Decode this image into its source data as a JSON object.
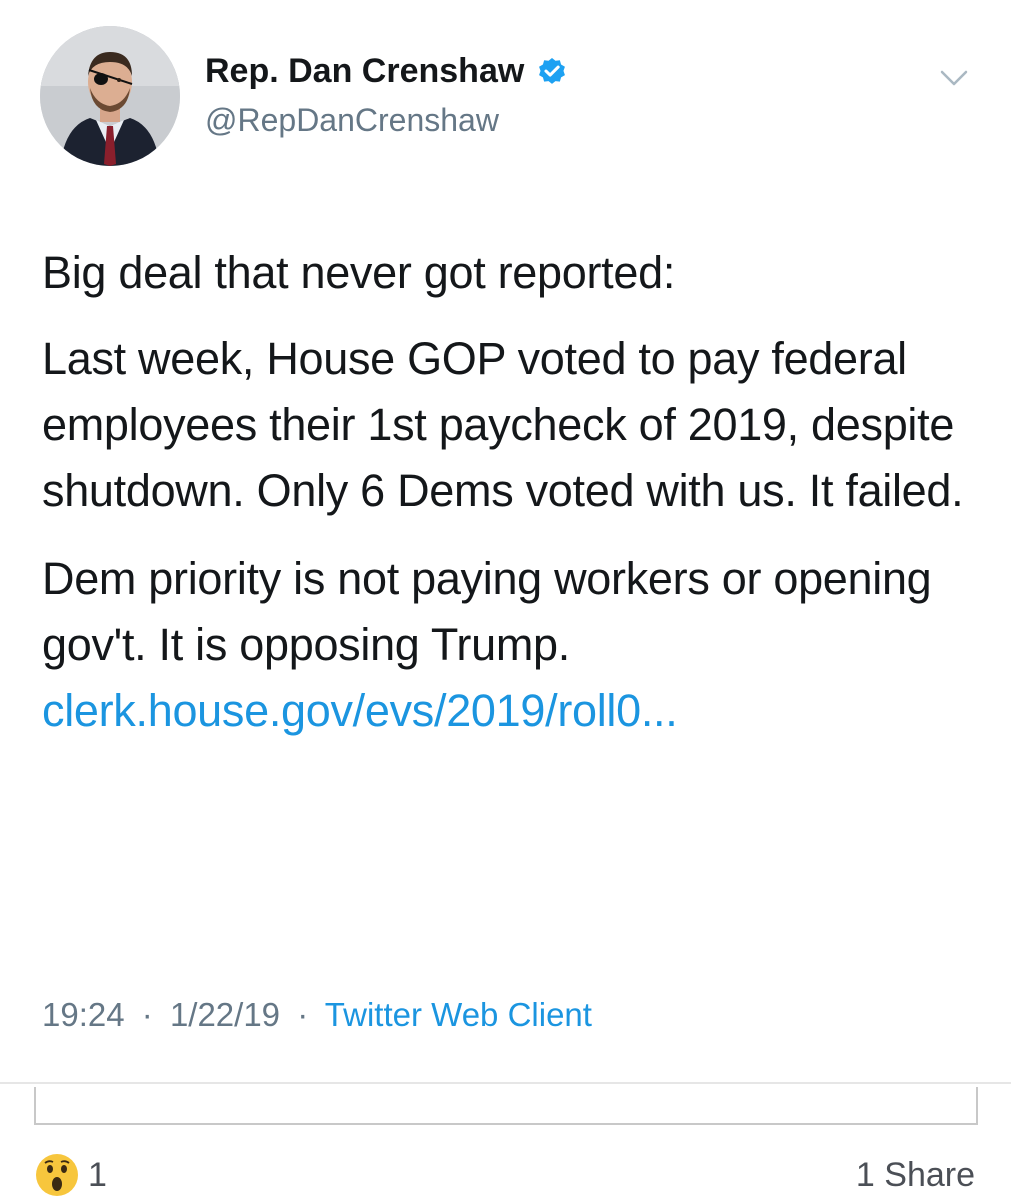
{
  "tweet": {
    "author": {
      "display_name": "Rep. Dan Crenshaw",
      "handle": "@RepDanCrenshaw",
      "verified": true
    },
    "paragraphs": [
      "Big deal that never got reported:",
      "Last week, House GOP voted to pay federal employees their 1st paycheck of 2019, despite shutdown. Only 6 Dems voted with us. It failed.",
      "Dem priority is not paying workers or opening gov't. It is opposing Trump."
    ],
    "link_text": "clerk.house.gov/evs/2019/roll0...",
    "time": "19:24",
    "date": "1/22/19",
    "separator": "·",
    "source": "Twitter Web Client"
  },
  "footer": {
    "reaction_count": "1",
    "share_text": "1 Share"
  },
  "colors": {
    "link": "#1b95e0",
    "verified": "#1da1f2",
    "muted_text": "#657786"
  },
  "icons": {
    "avatar": "profile-photo",
    "verified": "verified-badge-icon",
    "menu": "chevron-down-icon",
    "reaction": "wow-emoji-icon"
  }
}
